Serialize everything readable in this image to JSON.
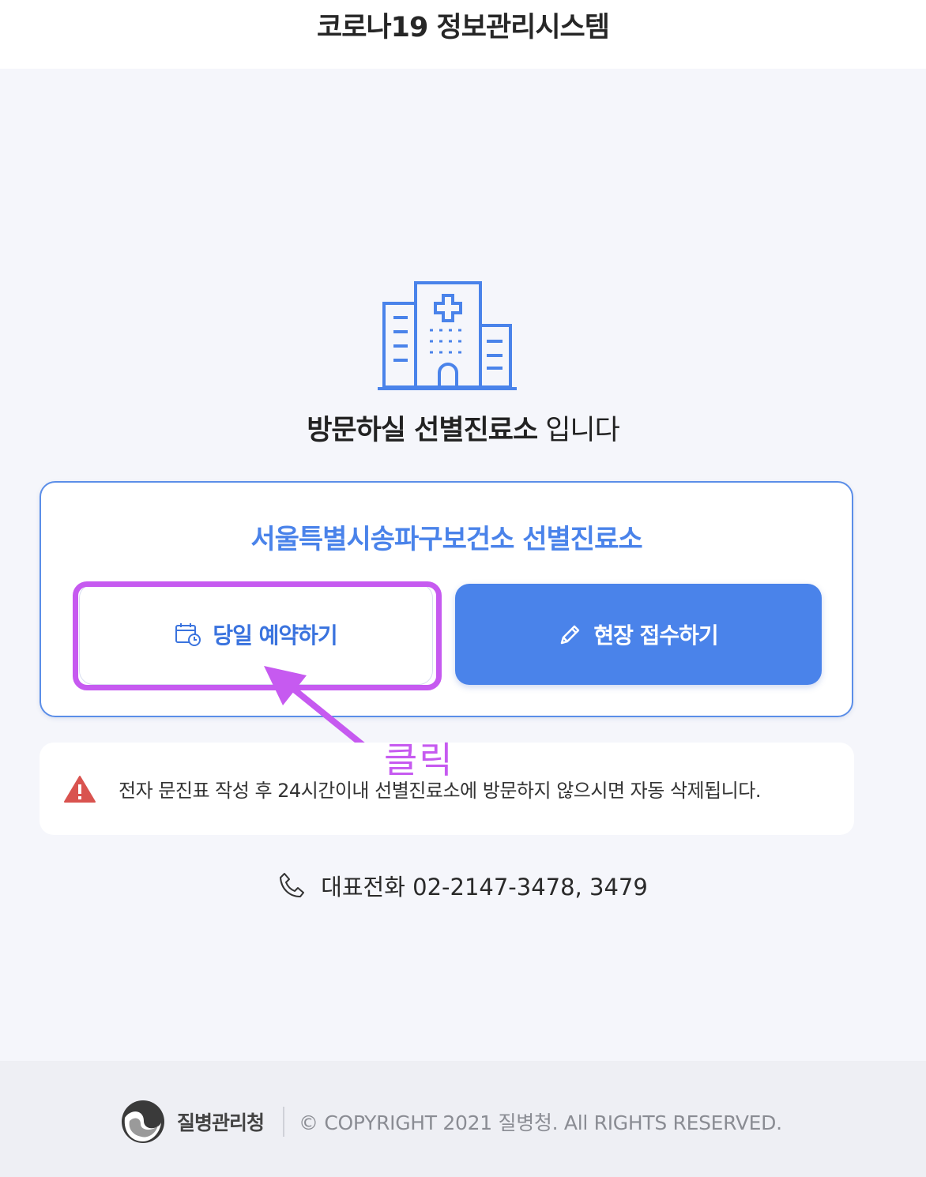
{
  "header": {
    "title": "코로나19 정보관리시스템"
  },
  "main": {
    "heading_bold": "방문하실 선별진료소",
    "heading_rest": "입니다",
    "center_name": "서울특별시송파구보건소 선별진료소",
    "reserve_button_label": "당일 예약하기",
    "onsite_button_label": "현장 접수하기"
  },
  "annotation": {
    "click_label": "클릭",
    "color": "#c65af0"
  },
  "notice": {
    "text": "전자 문진표 작성 후 24시간이내 선별진료소에 방문하지 않으시면 자동 삭제됩니다."
  },
  "contact": {
    "phone_text": "대표전화 02-2147-3478, 3479"
  },
  "footer": {
    "org_name": "질병관리청",
    "copyright": "© COPYRIGHT 2021 질병청. All RIGHTS RESERVED."
  },
  "icons": {
    "hospital": "hospital-building-icon",
    "calendar": "calendar-clock-icon",
    "pencil": "pencil-icon",
    "warning": "warning-triangle-icon",
    "phone": "phone-icon",
    "logo": "kdca-logo-icon"
  },
  "colors": {
    "accent": "#4a83ea",
    "warning": "#d9534f",
    "background": "#f5f6fb"
  }
}
